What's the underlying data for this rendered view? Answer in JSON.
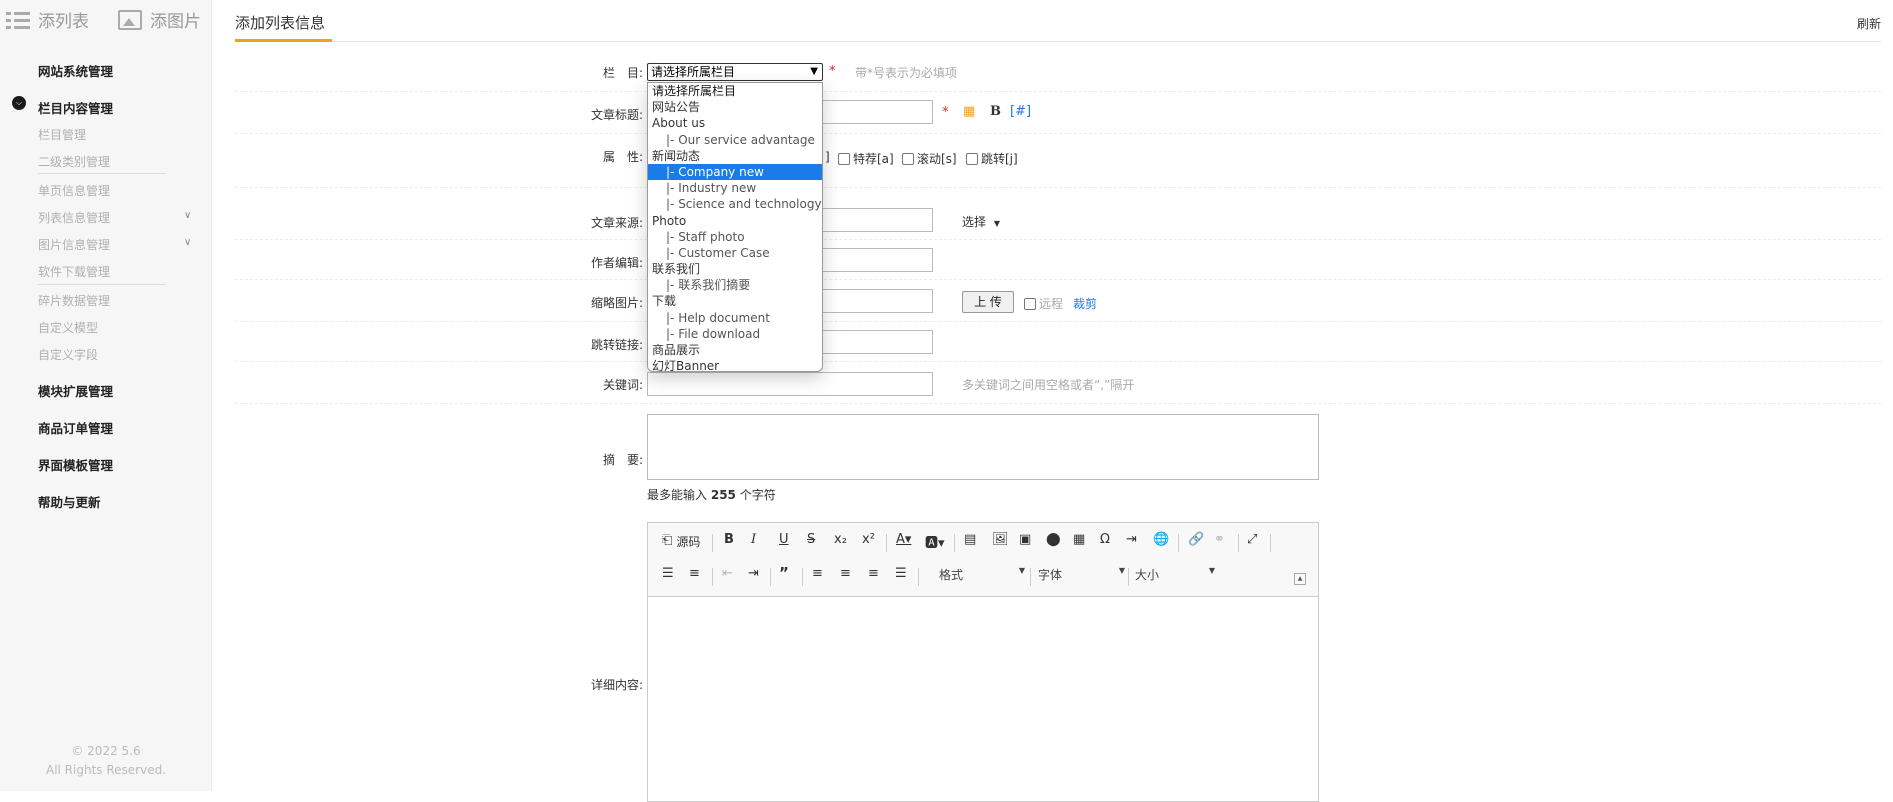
{
  "sidebar": {
    "tab_add_list": "添列表",
    "tab_add_image": "添图片",
    "items": [
      {
        "label": "网站系统管理"
      },
      {
        "label": "栏目内容管理"
      },
      {
        "label": "模块扩展管理"
      },
      {
        "label": "商品订单管理"
      },
      {
        "label": "界面模板管理"
      },
      {
        "label": "帮助与更新"
      }
    ],
    "sub_items": [
      {
        "label": "栏目管理"
      },
      {
        "label": "二级类别管理"
      },
      {
        "label": "单页信息管理"
      },
      {
        "label": "列表信息管理",
        "arrow": "∨"
      },
      {
        "label": "图片信息管理",
        "arrow": "∨"
      },
      {
        "label": "软件下载管理"
      },
      {
        "label": "碎片数据管理"
      },
      {
        "label": "自定义模型"
      },
      {
        "label": "自定义字段"
      }
    ],
    "footer_line1": "© 2022 5.6",
    "footer_line2": "All Rights Reserved."
  },
  "header": {
    "title": "添加列表信息",
    "refresh": "刷新"
  },
  "form": {
    "category_label": "栏　目:",
    "category_value": "请选择所属栏目",
    "required_mark": "*",
    "required_hint": "带*号表示为必填项",
    "title_label": "文章标题:",
    "bold_label": "B",
    "hash_label": "[#]",
    "attr_label": "属　性:",
    "attr_options": [
      {
        "label": "]"
      },
      {
        "label": "特荐[a]"
      },
      {
        "label": "滚动[s]"
      },
      {
        "label": "跳转[j]"
      }
    ],
    "source_label": "文章来源:",
    "source_select": "选择",
    "author_label": "作者编辑:",
    "thumb_label": "缩略图片:",
    "upload_button": "上 传",
    "remote_label": "远程",
    "crop_link": "裁剪",
    "jump_label": "跳转链接:",
    "keyword_label": "关键词:",
    "keyword_hint": "多关键词之间用空格或者“,”隔开",
    "summary_label": "摘　要:",
    "summary_limit_prefix": "最多能输入",
    "summary_limit_num": "255",
    "summary_limit_suffix": "个字符",
    "content_label": "详细内容:"
  },
  "dropdown": {
    "options": [
      {
        "label": "请选择所属栏目",
        "level": 0
      },
      {
        "label": "网站公告",
        "level": 0
      },
      {
        "label": "About us",
        "level": 0
      },
      {
        "label": "|- Our service advantage",
        "level": 1
      },
      {
        "label": "新闻动态",
        "level": 0
      },
      {
        "label": "|- Company new",
        "level": 1,
        "selected": true
      },
      {
        "label": "|- Industry new",
        "level": 1
      },
      {
        "label": "|- Science and technology",
        "level": 1
      },
      {
        "label": "Photo",
        "level": 0
      },
      {
        "label": "|- Staff photo",
        "level": 1
      },
      {
        "label": "|- Customer Case",
        "level": 1
      },
      {
        "label": "联系我们",
        "level": 0
      },
      {
        "label": "|- 联系我们摘要",
        "level": 1
      },
      {
        "label": "下载",
        "level": 0
      },
      {
        "label": "|- Help document",
        "level": 1
      },
      {
        "label": "|- File download",
        "level": 1
      },
      {
        "label": "商品展示",
        "level": 0
      },
      {
        "label": "幻灯Banner",
        "level": 0
      }
    ]
  },
  "editor": {
    "source_label": "源码",
    "format_label": "格式",
    "font_label": "字体",
    "size_label": "大小"
  },
  "colors": {
    "accent": "#f0a020",
    "selected_option": "#1a7ce8",
    "required": "#e02020",
    "link": "#1a7ce8"
  }
}
